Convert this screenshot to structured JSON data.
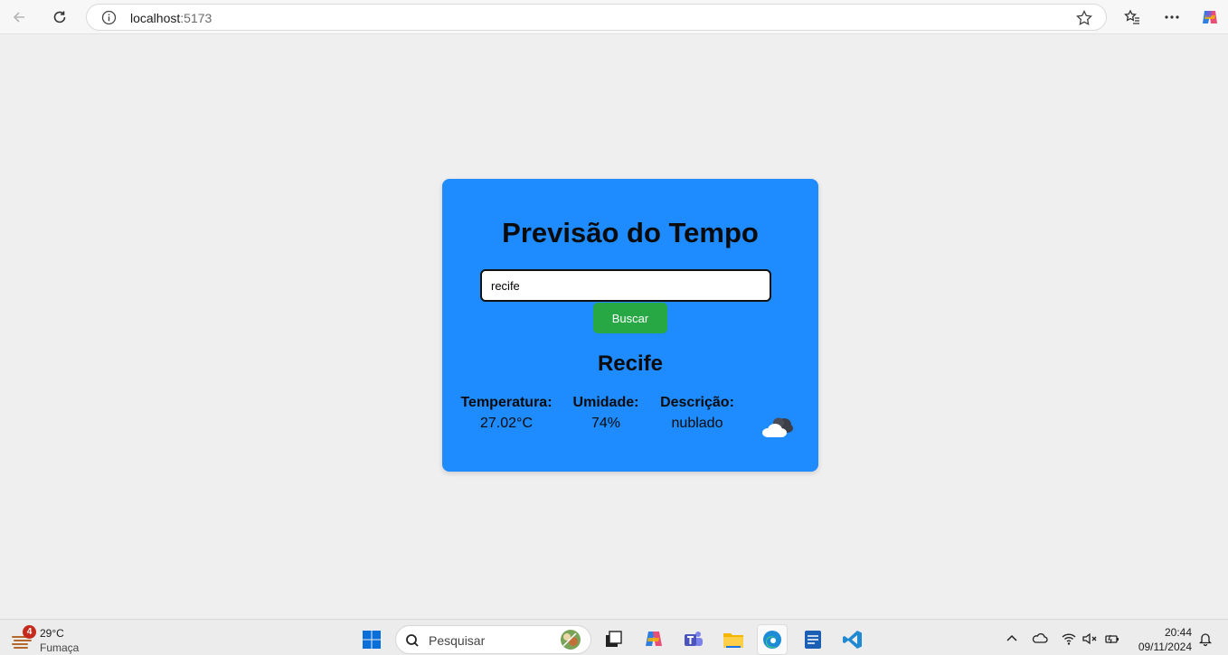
{
  "browser": {
    "url_host": "localhost",
    "url_port": ":5173"
  },
  "app": {
    "title": "Previsão do Tempo",
    "search_value": "recife",
    "search_button": "Buscar",
    "city": "Recife",
    "stats": [
      {
        "label": "Temperatura:",
        "value": "27.02°C"
      },
      {
        "label": "Umidade:",
        "value": "74%"
      },
      {
        "label": "Descrição:",
        "value": "nublado"
      }
    ],
    "weather_icon": "cloud-icon"
  },
  "taskbar": {
    "weather_badge": "4",
    "weather_temp": "29°C",
    "weather_desc": "Fumaça",
    "search_placeholder": "Pesquisar",
    "time": "20:44",
    "date": "09/11/2024"
  },
  "colors": {
    "card": "#1e8bff",
    "button": "#28a745",
    "page_bg": "#efefef"
  }
}
